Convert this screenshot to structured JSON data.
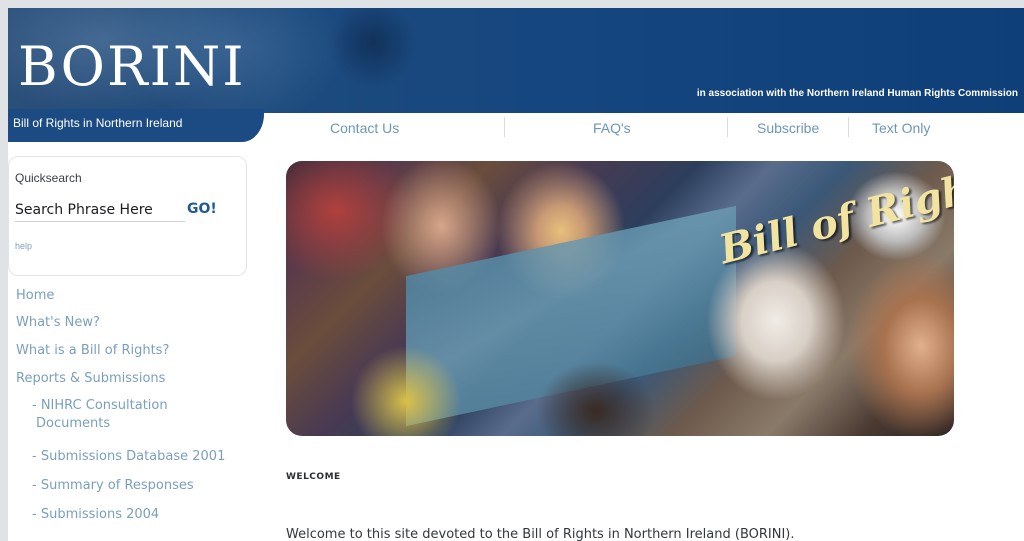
{
  "header": {
    "logo_text": "BORINI",
    "tagline": "Bill of Rights in Northern Ireland",
    "association": "in association with the Northern Ireland Human Rights Commission"
  },
  "nav": {
    "items": [
      {
        "label": "Contact Us"
      },
      {
        "label": "FAQ's"
      },
      {
        "label": "Subscribe"
      },
      {
        "label": "Text Only"
      }
    ]
  },
  "quicksearch": {
    "label": "Quicksearch",
    "placeholder": "Search Phrase Here",
    "go_label": "GO!",
    "help_label": "help"
  },
  "sidebar": {
    "links": [
      {
        "label": "Home"
      },
      {
        "label": "What's New?"
      },
      {
        "label": "What is a Bill of Rights?"
      },
      {
        "label": "Reports & Submissions"
      }
    ],
    "sublinks": [
      {
        "label": "- NIHRC Consultation"
      },
      {
        "label": "Documents"
      },
      {
        "label": "- Submissions Database 2001"
      },
      {
        "label": "- Summary of Responses"
      },
      {
        "label": "- Submissions 2004"
      }
    ]
  },
  "hero": {
    "banner_text": "Bill of Rights"
  },
  "content": {
    "welcome_heading": "WELCOME",
    "welcome_text": "Welcome to this site devoted to the Bill of Rights in Northern Ireland (BORINI)."
  },
  "colors": {
    "header_blue": "#1b4b82",
    "link_blue": "#7a9fbe",
    "go_blue": "#1f5a97"
  }
}
